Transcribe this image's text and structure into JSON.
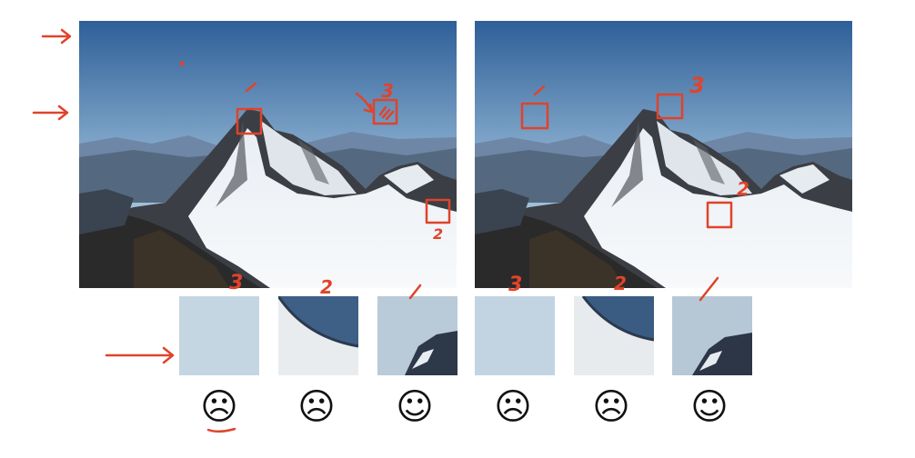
{
  "annotation_color": "#e0432b",
  "faces": {
    "sad": "☹",
    "happy": "☺"
  },
  "left_image": {
    "labels": [
      "1",
      "3",
      "2"
    ]
  },
  "right_image": {
    "labels": [
      "1",
      "3",
      "2"
    ]
  },
  "patch_labels": [
    "3",
    "2",
    "1",
    "3",
    "2",
    "1"
  ],
  "patch_ratings": [
    "sad",
    "sad",
    "happy",
    "sad",
    "sad",
    "happy"
  ],
  "patch_kinds": [
    "sky",
    "edge",
    "peak",
    "sky",
    "edge",
    "peak"
  ]
}
